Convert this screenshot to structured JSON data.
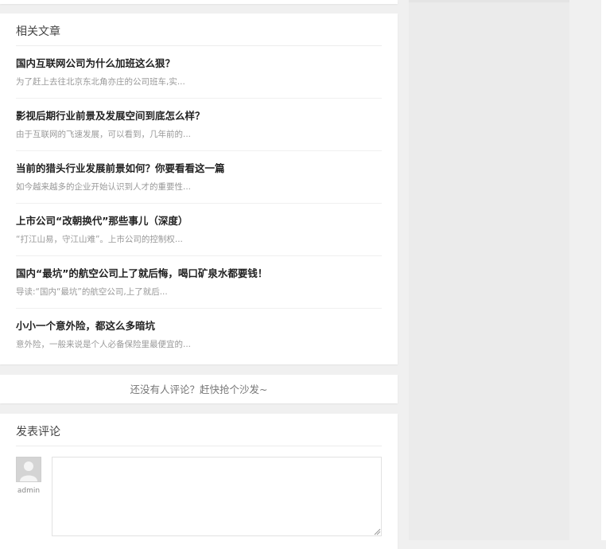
{
  "related": {
    "title": "相关文章",
    "articles": [
      {
        "title": "国内互联网公司为什么加班这么狠？",
        "summary": "为了赶上去往北京东北角亦庄的公司班车,实..."
      },
      {
        "title": "影视后期行业前景及发展空间到底怎么样？",
        "summary": "由于互联网的飞速发展，可以看到，几年前的..."
      },
      {
        "title": "当前的猎头行业发展前景如何？你要看看这一篇",
        "summary": "如今越来越多的企业开始认识到人才的重要性..."
      },
      {
        "title": "上市公司“改朝换代”那些事儿（深度）",
        "summary": "“打江山易，守江山难”。上市公司的控制权..."
      },
      {
        "title": "国内“最坑”的航空公司上了就后悔，喝口矿泉水都要钱！",
        "summary": "导读:“国内“最坑”的航空公司,上了就后..."
      },
      {
        "title": "小小一个意外险，都这么多暗坑",
        "summary": "意外险，一般来说是个人必备保险里最便宜的..."
      }
    ]
  },
  "comments": {
    "empty_text": "还没有人评论？赶快抢个沙发~"
  },
  "comment_form": {
    "title": "发表评论",
    "user": "admin",
    "textarea_value": "",
    "avatar_icon": "user-avatar-icon"
  },
  "colors": {
    "background": "#f0f0f0",
    "card": "#ffffff",
    "title_text": "#222222",
    "summary_text": "#999999"
  }
}
